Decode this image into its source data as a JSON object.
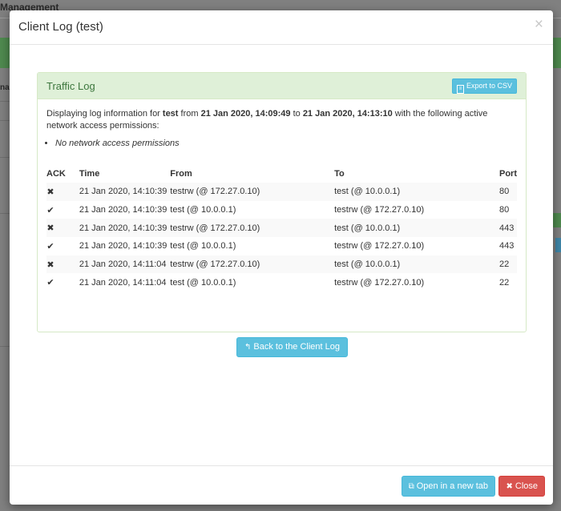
{
  "background": {
    "title": "Management",
    "sidebar_fragment": "na"
  },
  "modal": {
    "title": "Client Log (test)",
    "close_glyph": "×"
  },
  "panel": {
    "title": "Traffic Log",
    "export_label": "Export to CSV",
    "intro": {
      "prefix": "Displaying log information for ",
      "user": "test",
      "from_word": " from ",
      "start": "21 Jan 2020, 14:09:49",
      "to_word": " to ",
      "end": "21 Jan 2020, 14:13:10",
      "suffix": " with the following active network access permissions:"
    },
    "permissions": [
      "No network access permissions"
    ],
    "columns": {
      "ack": "ACK",
      "time": "Time",
      "from": "From",
      "to": "To",
      "port": "Port"
    },
    "rows": [
      {
        "ack": "cross",
        "time": "21 Jan 2020, 14:10:39",
        "from": "testrw (@ 172.27.0.10)",
        "to": "test (@ 10.0.0.1)",
        "port": "80"
      },
      {
        "ack": "check",
        "time": "21 Jan 2020, 14:10:39",
        "from": "test (@ 10.0.0.1)",
        "to": "testrw (@ 172.27.0.10)",
        "port": "80"
      },
      {
        "ack": "cross",
        "time": "21 Jan 2020, 14:10:39",
        "from": "testrw (@ 172.27.0.10)",
        "to": "test (@ 10.0.0.1)",
        "port": "443"
      },
      {
        "ack": "check",
        "time": "21 Jan 2020, 14:10:39",
        "from": "test (@ 10.0.0.1)",
        "to": "testrw (@ 172.27.0.10)",
        "port": "443"
      },
      {
        "ack": "cross",
        "time": "21 Jan 2020, 14:11:04",
        "from": "testrw (@ 172.27.0.10)",
        "to": "test (@ 10.0.0.1)",
        "port": "22"
      },
      {
        "ack": "check",
        "time": "21 Jan 2020, 14:11:04",
        "from": "test (@ 10.0.0.1)",
        "to": "testrw (@ 172.27.0.10)",
        "port": "22"
      }
    ],
    "back_label": "Back to the Client Log"
  },
  "footer": {
    "open_label": "Open in a new tab",
    "close_label": "Close"
  },
  "icons": {
    "check": "✔",
    "cross": "✖",
    "back": "↰",
    "external": "⧉",
    "close": "✖",
    "file": "≡"
  },
  "colors": {
    "info": "#5bc0de",
    "danger": "#d9534f",
    "panel_heading": "#dff0d8",
    "panel_title": "#3c763d"
  }
}
